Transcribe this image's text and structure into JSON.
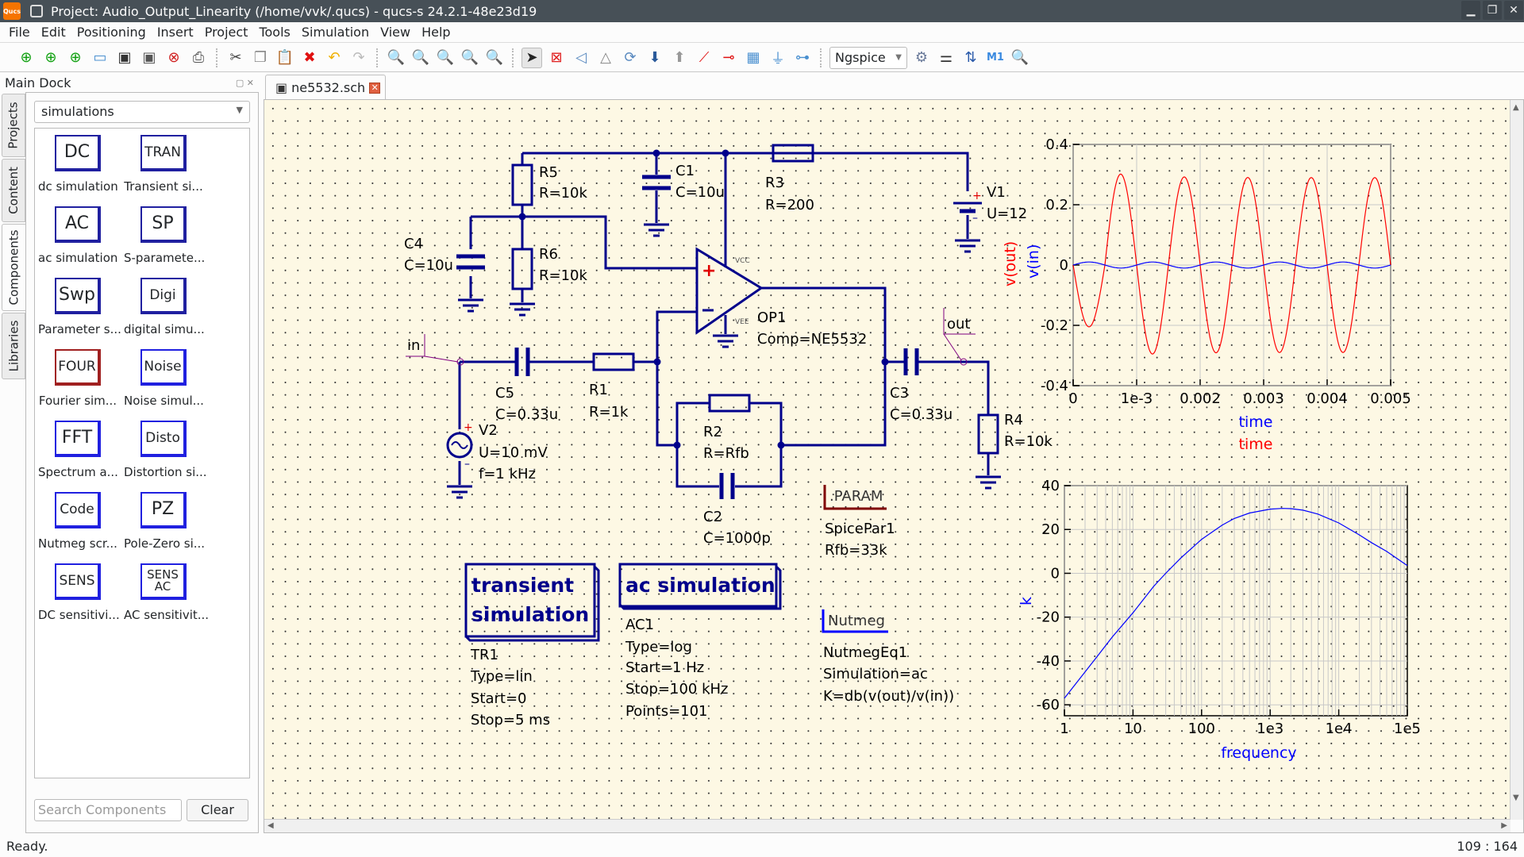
{
  "window": {
    "title": "Project: Audio_Output_Linearity (/home/vvk/.qucs) - qucs-s 24.2.1-48e23d19",
    "app_icon_label": "Qucs"
  },
  "menu": [
    "File",
    "Edit",
    "Positioning",
    "Insert",
    "Project",
    "Tools",
    "Simulation",
    "View",
    "Help"
  ],
  "toolbar": {
    "simulator": "Ngspice",
    "file_icons": [
      "new-schematic-icon",
      "new-text-icon",
      "new-symbol-icon",
      "open-icon",
      "save-icon",
      "save-all-icon",
      "close-doc-icon",
      "print-icon"
    ],
    "edit_icons": [
      "cut-icon",
      "copy-icon",
      "paste-icon",
      "delete-icon",
      "undo-icon",
      "redo-icon"
    ],
    "zoom_icons": [
      "zoom-fit-icon",
      "zoom-selection-icon",
      "zoom-1to1-icon",
      "zoom-in-icon",
      "zoom-out-icon"
    ],
    "tool_icons": [
      "select-icon",
      "deactivate-icon",
      "mirror-x-icon",
      "mirror-y-icon",
      "rotate-icon",
      "enter-subcircuit-icon",
      "leave-subcircuit-icon",
      "wire-icon",
      "wire-label-icon",
      "equation-icon",
      "ground-icon",
      "port-icon"
    ],
    "sim_icons": [
      "simulate-icon",
      "tune-icon",
      "dpl-toggle-icon",
      "marker-icon",
      "zoom-diagram-icon"
    ]
  },
  "dock": {
    "title": "Main Dock",
    "tabs": [
      "Projects",
      "Content",
      "Components",
      "Libraries"
    ],
    "selected_tab": "Components",
    "category": "simulations",
    "components": [
      {
        "icon": "DC",
        "label": "dc simulation",
        "style": "dark"
      },
      {
        "icon": "TRAN",
        "label": "Transient si...",
        "style": "dark"
      },
      {
        "icon": "AC",
        "label": "ac simulation",
        "style": "dark"
      },
      {
        "icon": "SP",
        "label": "S-paramete...",
        "style": "dark"
      },
      {
        "icon": "Swp",
        "label": "Parameter s...",
        "style": "dark"
      },
      {
        "icon": "Digi",
        "label": "digital simu...",
        "style": "dark"
      },
      {
        "icon": "FOUR",
        "label": "Fourier sim...",
        "style": "red"
      },
      {
        "icon": "Noise",
        "label": "Noise simul...",
        "style": "blue"
      },
      {
        "icon": "FFT",
        "label": "Spectrum a...",
        "style": "blue"
      },
      {
        "icon": "Disto",
        "label": "Distortion si...",
        "style": "blue"
      },
      {
        "icon": "Code",
        "label": "Nutmeg scr...",
        "style": "blue"
      },
      {
        "icon": "PZ",
        "label": "Pole-Zero si...",
        "style": "blue"
      },
      {
        "icon": "SENS",
        "label": "DC sensitivi...",
        "style": "blue"
      },
      {
        "icon": "SENS AC",
        "label": "AC sensitivit...",
        "style": "blue"
      }
    ],
    "search_placeholder": "Search Components",
    "clear_label": "Clear"
  },
  "document_tab": {
    "name": "ne5532.sch"
  },
  "schematic": {
    "components": {
      "R5": {
        "name": "R5",
        "value": "R=10k"
      },
      "R6": {
        "name": "R6",
        "value": "R=10k"
      },
      "C1": {
        "name": "C1",
        "value": "C=10u"
      },
      "R3": {
        "name": "R3",
        "value": "R=200"
      },
      "V1": {
        "name": "V1",
        "value": "U=12"
      },
      "C4": {
        "name": "C4",
        "value": "C=10u"
      },
      "OP1": {
        "name": "OP1",
        "value": "Comp=NE5532",
        "vcc": "VCC",
        "vee": "VEE"
      },
      "C5": {
        "name": "C5",
        "value": "C=0.33u"
      },
      "R1": {
        "name": "R1",
        "value": "R=1k"
      },
      "V2": {
        "name": "V2",
        "value": "U=10 mV",
        "freq": "f=1 kHz"
      },
      "R2": {
        "name": "R2",
        "value": "R=Rfb"
      },
      "C2": {
        "name": "C2",
        "value": "C=1000p"
      },
      "C3": {
        "name": "C3",
        "value": "C=0.33u"
      },
      "R4": {
        "name": "R4",
        "value": "R=10k"
      }
    },
    "labels": {
      "in": "in",
      "out": "out"
    },
    "param": {
      "header": ".PARAM",
      "name": "SpicePar1",
      "value": "Rfb=33k"
    },
    "nutmeg": {
      "header": "Nutmeg",
      "name": "NutmegEq1",
      "sim": "Simulation=ac",
      "expr": "K=db(v(out)/v(in))"
    },
    "tran": {
      "title1": "transient",
      "title2": "simulation",
      "name": "TR1",
      "type": "Type=lin",
      "start": "Start=0",
      "stop": "Stop=5 ms"
    },
    "ac": {
      "title": "ac simulation",
      "name": "AC1",
      "type": "Type=log",
      "start": "Start=1 Hz",
      "stop": "Stop=100 kHz",
      "points": "Points=101"
    }
  },
  "chart_data": [
    {
      "type": "line",
      "title": "",
      "xlabel": [
        "time",
        "time"
      ],
      "ylabel": [
        "v(out)",
        "v(in)"
      ],
      "xlim": [
        0,
        0.005
      ],
      "ylim": [
        -0.4,
        0.4
      ],
      "x_ticks": [
        "0",
        "1e-3",
        "0.002",
        "0.003",
        "0.004",
        "0.005"
      ],
      "y_ticks": [
        "0.4",
        "0.2",
        "0",
        "-0.2",
        "-0.4"
      ],
      "grid": true,
      "series": [
        {
          "name": "v(out)",
          "color": "#ff0000",
          "kind": "sine",
          "frequency_hz": 1000,
          "amplitude": 0.29,
          "phase": "inverted",
          "first_trough": -0.205,
          "first_peak": 0.305
        },
        {
          "name": "v(in)",
          "color": "#0000ff",
          "kind": "sine",
          "frequency_hz": 1000,
          "amplitude": 0.01
        }
      ]
    },
    {
      "type": "line",
      "title": "",
      "xlabel": "frequency",
      "ylabel": "k",
      "xscale": "log",
      "xlim": [
        1,
        100000
      ],
      "ylim": [
        -65,
        40
      ],
      "x_ticks": [
        "1",
        "10",
        "100",
        "1e3",
        "1e4",
        "1e5"
      ],
      "y_ticks": [
        "40",
        "20",
        "0",
        "-20",
        "-40",
        "-60"
      ],
      "grid": true,
      "series": [
        {
          "name": "k",
          "color": "#0000ff",
          "x": [
            1,
            2,
            3,
            5,
            10,
            20,
            30,
            50,
            100,
            200,
            300,
            500,
            1000,
            1500,
            2000,
            3000,
            5000,
            10000,
            20000,
            30000,
            50000,
            100000
          ],
          "y": [
            -57,
            -45,
            -38,
            -29,
            -18,
            -6,
            0,
            7,
            15.5,
            22,
            25,
            27.5,
            29.3,
            29.6,
            29.5,
            28.8,
            27,
            23,
            17.5,
            14,
            10,
            3.5
          ]
        }
      ]
    }
  ],
  "status": {
    "left": "Ready.",
    "right": "109 : 164"
  }
}
